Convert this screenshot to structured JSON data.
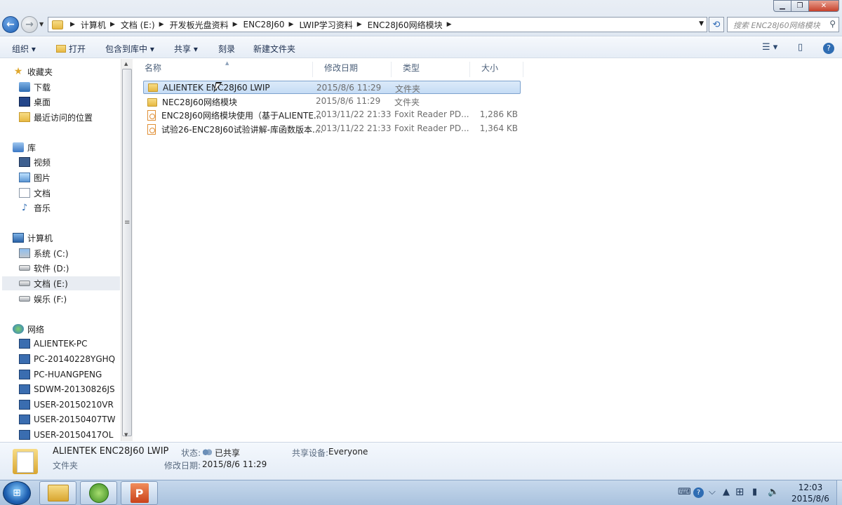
{
  "window": {
    "breadcrumbs": [
      "计算机",
      "文档 (E:)",
      "开发板光盘资料",
      "ENC28J60",
      "LWIP学习资料",
      "ENC28J60网络模块"
    ],
    "search_placeholder": "搜索 ENC28J60网络模块"
  },
  "toolbar": {
    "organize": "组织",
    "open": "打开",
    "include_in_library": "包含到库中",
    "share": "共享",
    "burn": "刻录",
    "new_folder": "新建文件夹"
  },
  "sidebar": {
    "favorites": {
      "label": "收藏夹",
      "items": [
        "下载",
        "桌面",
        "最近访问的位置"
      ]
    },
    "libraries": {
      "label": "库",
      "items": [
        "视频",
        "图片",
        "文档",
        "音乐"
      ]
    },
    "computer": {
      "label": "计算机",
      "items": [
        "系统 (C:)",
        "软件 (D:)",
        "文档 (E:)",
        "娱乐 (F:)"
      ],
      "selected": "文档 (E:)"
    },
    "network": {
      "label": "网络",
      "items": [
        "ALIENTEK-PC",
        "PC-20140228YGHQ",
        "PC-HUANGPENG",
        "SDWM-20130826JS",
        "USER-20150210VR",
        "USER-20150407TW",
        "USER-20150417OL"
      ]
    }
  },
  "columns": {
    "name": "名称",
    "date": "修改日期",
    "type": "类型",
    "size": "大小"
  },
  "files": [
    {
      "name": "ALIENTEK ENC28J60 LWIP",
      "date": "2015/8/6 11:29",
      "type": "文件夹",
      "size": "",
      "icon": "folder-icon",
      "selected": true
    },
    {
      "name": "NEC28J60网络模块",
      "date": "2015/8/6 11:29",
      "type": "文件夹",
      "size": "",
      "icon": "folder-icon",
      "selected": false
    },
    {
      "name": "ENC28J60网络模块使用（基于ALIENTE...",
      "date": "2013/11/22 21:33",
      "type": "Foxit Reader PD...",
      "size": "1,286 KB",
      "icon": "pdf-icon",
      "selected": false
    },
    {
      "name": "试验26-ENC28J60试验讲解-库函数版本....",
      "date": "2013/11/22 21:33",
      "type": "Foxit Reader PD...",
      "size": "1,364 KB",
      "icon": "pdf-icon",
      "selected": false
    }
  ],
  "details": {
    "name": "ALIENTEK ENC28J60 LWIP",
    "kind": "文件夹",
    "status_label": "状态:",
    "status_value": "已共享",
    "modified_label": "修改日期:",
    "modified_value": "2015/8/6 11:29",
    "shared_with_label": "共享设备:",
    "shared_with_value": "Everyone"
  },
  "taskbar": {
    "time": "12:03",
    "date": "2015/8/6"
  }
}
